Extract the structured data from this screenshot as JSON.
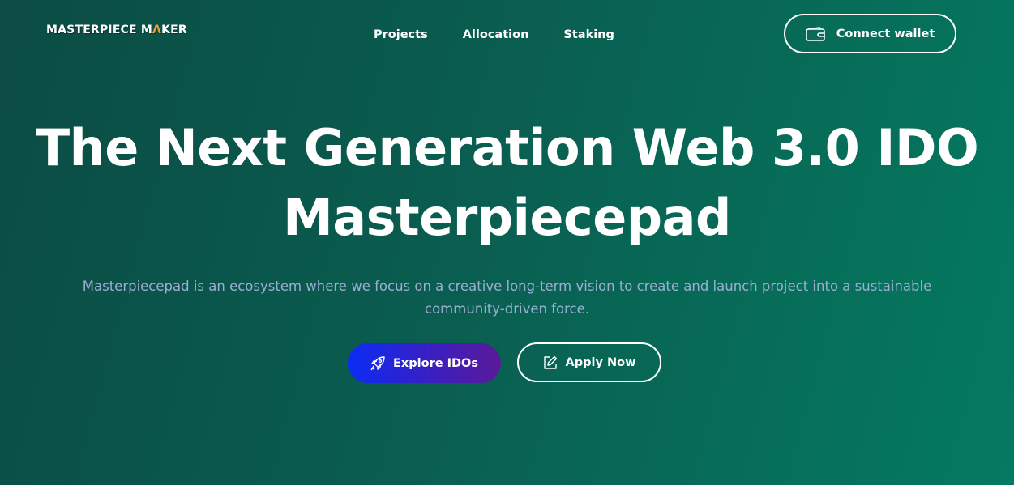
{
  "header": {
    "logo_text_part1": "MASTERPIECE M",
    "logo_accent_char": "Λ",
    "logo_text_part2": "KER",
    "nav": [
      {
        "label": "Projects"
      },
      {
        "label": "Allocation"
      },
      {
        "label": "Staking"
      }
    ],
    "connect_label": "Connect wallet",
    "connect_icon": "wallet-icon"
  },
  "hero": {
    "title_line1": "The Next Generation Web 3.0 IDO",
    "title_line2": "Masterpiecepad",
    "subtitle": "Masterpiecepad is an ecosystem where we focus on a creative long-term vision to create and launch project into a sustainable community-driven force.",
    "explore_label": "Explore IDOs",
    "explore_icon": "rocket-icon",
    "apply_label": "Apply Now",
    "apply_icon": "edit-icon"
  },
  "colors": {
    "background_start": "#0b4c44",
    "background_end": "#047a60",
    "subtitle": "#9aaed4",
    "logo_accent": "#e8a03a",
    "explore_gradient_start": "#0b2cf5",
    "explore_gradient_end": "#5b1a9a"
  }
}
